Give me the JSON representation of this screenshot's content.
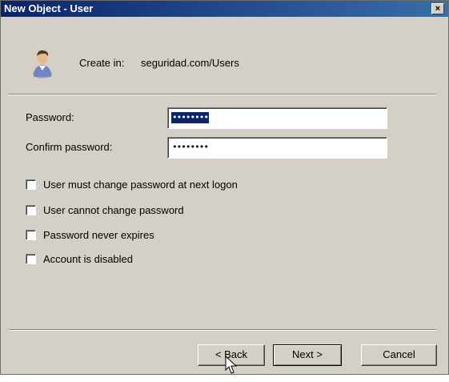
{
  "window": {
    "title": "New Object - User",
    "close_label": "×"
  },
  "header": {
    "create_in_label": "Create in:",
    "create_in_path": "seguridad.com/Users",
    "icon": "user-icon"
  },
  "fields": {
    "password_label": "Password:",
    "password_value": "••••••••",
    "confirm_label": "Confirm password:",
    "confirm_value": "••••••••"
  },
  "options": [
    {
      "label": "User must change password at next logon",
      "checked": false
    },
    {
      "label": "User cannot change password",
      "checked": false
    },
    {
      "label": "Password never expires",
      "checked": false
    },
    {
      "label": "Account is disabled",
      "checked": false
    }
  ],
  "buttons": {
    "back": "< Back",
    "next": "Next >",
    "cancel": "Cancel"
  },
  "colors": {
    "title_start": "#0a246a",
    "title_end": "#3a6ea5",
    "dialog_bg": "#d4d0c8",
    "selection": "#0a246a"
  }
}
